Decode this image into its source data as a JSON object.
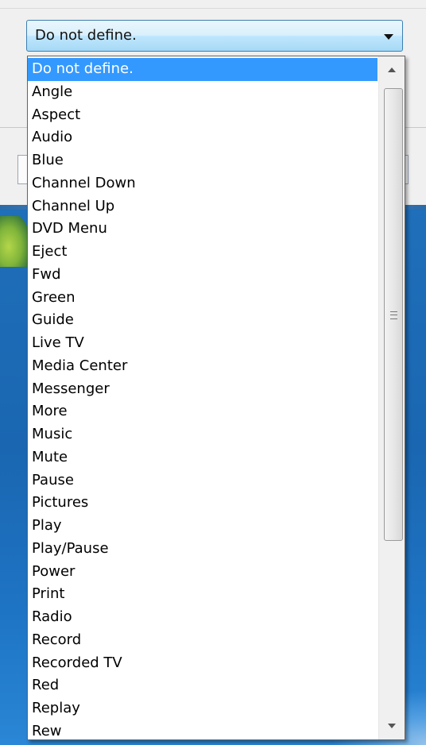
{
  "combo": {
    "value": "Do not define."
  },
  "dropdown": {
    "items": [
      "Do not define.",
      "Angle",
      "Aspect",
      "Audio",
      "Blue",
      "Channel Down",
      "Channel Up",
      "DVD Menu",
      "Eject",
      "Fwd",
      "Green",
      "Guide",
      "Live TV",
      "Media Center",
      "Messenger",
      "More",
      "Music",
      "Mute",
      "Pause",
      "Pictures",
      "Play",
      "Play/Pause",
      "Power",
      "Print",
      "Radio",
      "Record",
      "Recorded TV",
      "Red",
      "Replay",
      "Rew"
    ],
    "selected_index": 0
  },
  "icons": {
    "combo_arrow": "chevron-down-icon",
    "scroll_up": "scroll-up-arrow-icon",
    "scroll_down": "scroll-down-arrow-icon",
    "thumb_grip": "grip-icon"
  },
  "colors": {
    "selection": "#3399ff",
    "combo_border": "#3c7fb1",
    "desktop_blue": "#1a66b1"
  }
}
